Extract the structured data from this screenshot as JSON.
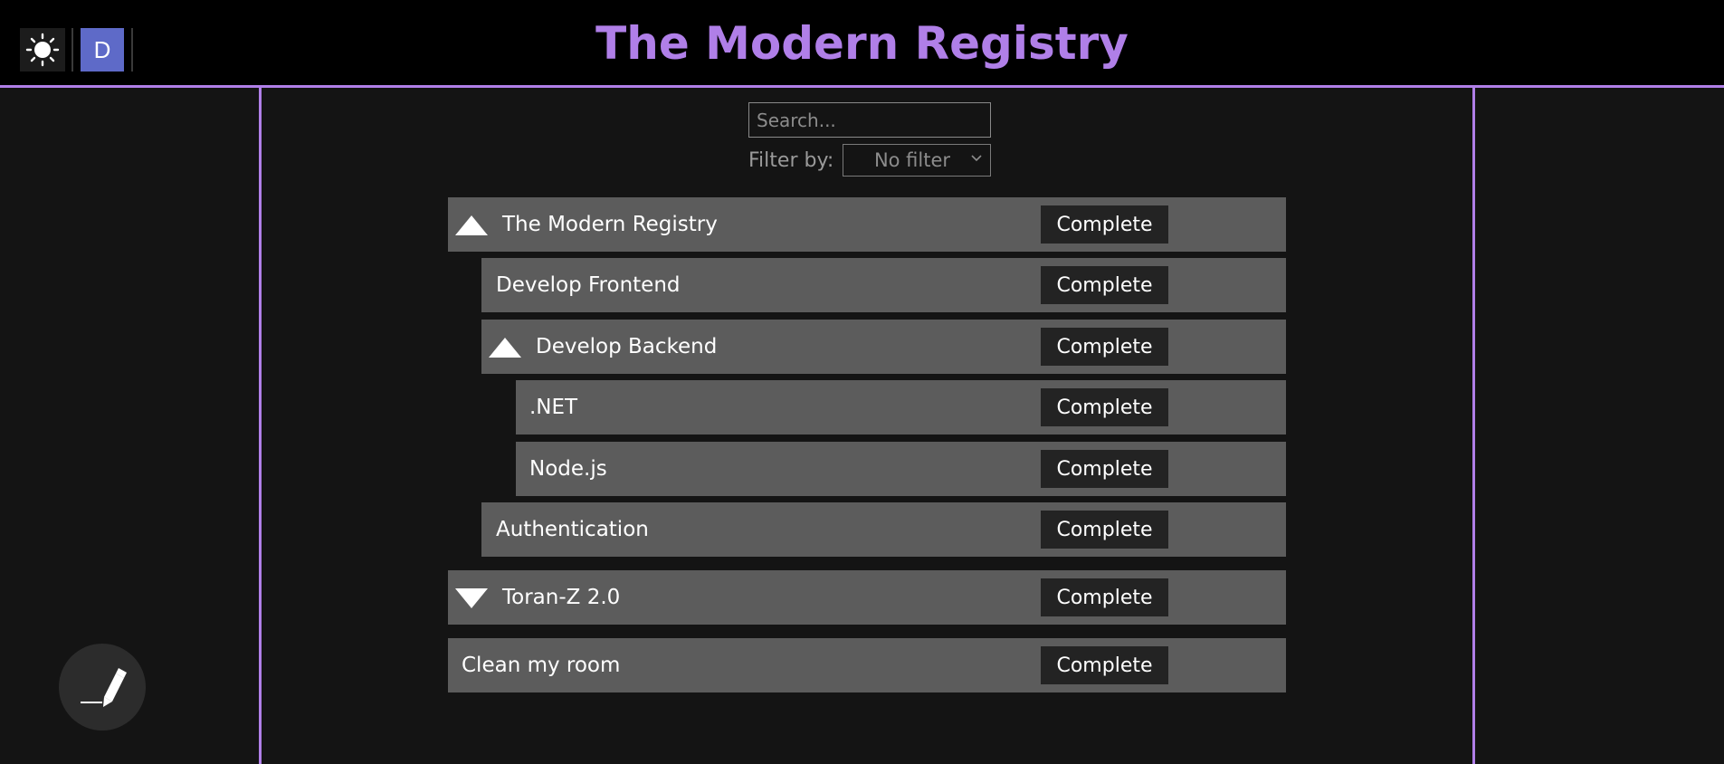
{
  "header": {
    "title": "The Modern Registry",
    "theme_icon": "sun-icon",
    "avatar_initial": "D"
  },
  "controls": {
    "search_placeholder": "Search...",
    "search_value": "",
    "filter_label": "Filter by:",
    "filter_value": "No filter"
  },
  "tasks": [
    {
      "label": "The Modern Registry",
      "expand_state": "expanded",
      "button": "Complete"
    },
    {
      "label": "Develop Frontend",
      "button": "Complete"
    },
    {
      "label": "Develop Backend",
      "expand_state": "expanded",
      "button": "Complete"
    },
    {
      "label": ".NET",
      "button": "Complete"
    },
    {
      "label": "Node.js",
      "button": "Complete"
    },
    {
      "label": "Authentication",
      "button": "Complete"
    },
    {
      "label": "Toran-Z 2.0",
      "expand_state": "collapsed",
      "button": "Complete"
    },
    {
      "label": "Clean my room",
      "button": "Complete"
    }
  ],
  "fab_icon": "pen-icon",
  "colors": {
    "accent": "#b07fe8",
    "header_bg": "#000000",
    "page_bg": "#141414",
    "row_bg": "#5c5c5c",
    "button_bg": "#232323",
    "avatar_bg": "#5e6ac8"
  }
}
